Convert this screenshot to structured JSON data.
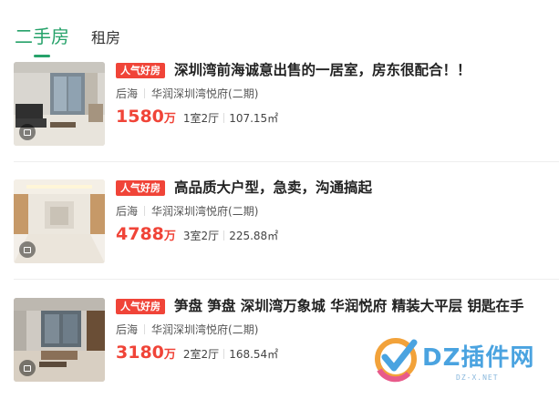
{
  "tabs": {
    "active_label": "二手房",
    "inactive_label": "租房"
  },
  "listings": [
    {
      "tag": "人气好房",
      "title": "深圳湾前海诚意出售的一居室，房东很配合！！",
      "district": "后海",
      "community": "华润深圳湾悦府(二期)",
      "price": "1580",
      "price_unit": "万",
      "layout": "1室2厅",
      "area": "107.15㎡"
    },
    {
      "tag": "人气好房",
      "title": "高品质大户型，急卖，沟通搞起",
      "district": "后海",
      "community": "华润深圳湾悦府(二期)",
      "price": "4788",
      "price_unit": "万",
      "layout": "3室2厅",
      "area": "225.88㎡"
    },
    {
      "tag": "人气好房",
      "title": "笋盘 笋盘 深圳湾万象城 华润悦府 精装大平层 钥匙在手",
      "district": "后海",
      "community": "华润深圳湾悦府(二期)",
      "price": "3180",
      "price_unit": "万",
      "layout": "2室2厅",
      "area": "168.54㎡"
    }
  ],
  "watermark": {
    "text": "DZ插件网",
    "sub": "DZ-X.NET"
  },
  "colors": {
    "accent_green": "#26a26a",
    "price_red": "#f04438",
    "tag_red": "#f04438"
  }
}
